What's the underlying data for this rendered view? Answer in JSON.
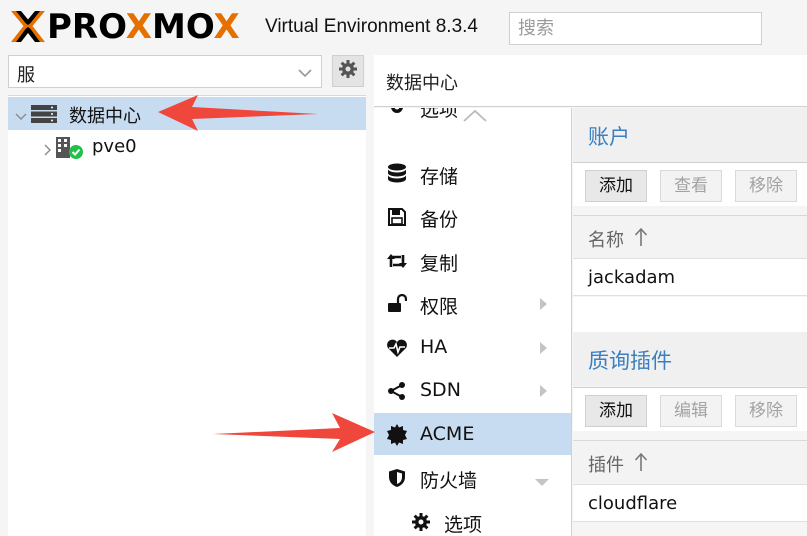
{
  "header": {
    "logo_text": "PROXMOX",
    "version": "Virtual Environment 8.3.4",
    "search_placeholder": "搜索"
  },
  "left_panel": {
    "view_selector": "服务器视图",
    "tree": [
      {
        "label": "数据中心",
        "icon": "datacenter-icon",
        "selected": true,
        "expanded": true
      },
      {
        "label": "pve0",
        "icon": "node-online-icon",
        "selected": false,
        "expanded": false
      }
    ]
  },
  "right_panel": {
    "title": "数据中心",
    "nav": [
      {
        "label": "选项",
        "icon": "gear-icon",
        "partial": true
      },
      {
        "label": "存储",
        "icon": "database-icon"
      },
      {
        "label": "备份",
        "icon": "save-icon"
      },
      {
        "label": "复制",
        "icon": "retweet-icon"
      },
      {
        "label": "权限",
        "icon": "unlock-icon",
        "arrow": "right"
      },
      {
        "label": "HA",
        "icon": "heartbeat-icon",
        "arrow": "right"
      },
      {
        "label": "SDN",
        "icon": "share-alt-icon",
        "arrow": "right"
      },
      {
        "label": "ACME",
        "icon": "certificate-icon",
        "active": true
      },
      {
        "label": "防火墙",
        "icon": "shield-icon",
        "arrow": "down"
      },
      {
        "label": "选项",
        "icon": "gear-icon",
        "sub": true
      }
    ]
  },
  "accounts": {
    "title": "账户",
    "buttons": [
      "添加",
      "查看",
      "移除"
    ],
    "column": "名称",
    "rows": [
      "jackadam"
    ]
  },
  "plugins": {
    "title": "质询插件",
    "buttons": [
      "添加",
      "编辑",
      "移除"
    ],
    "column": "插件",
    "rows": [
      "cloudflare"
    ]
  },
  "colors": {
    "brand_orange": "#e57000",
    "selection": "#c7dcf1",
    "section_title": "#3a7fc1",
    "annotation_red": "#f0473d"
  }
}
